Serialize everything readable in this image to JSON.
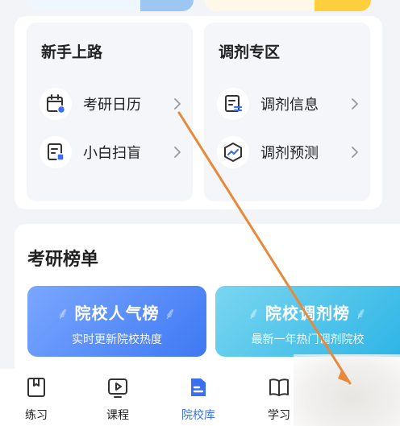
{
  "colors": {
    "accent": "#3a6ff0",
    "arrow": "#e8893a",
    "rank_blue": "#4a82f5",
    "rank_cyan": "#38bde8"
  },
  "newbie": {
    "title": "新手上路",
    "items": [
      {
        "label": "考研日历",
        "icon": "calendar-icon"
      },
      {
        "label": "小白扫盲",
        "icon": "document-icon"
      }
    ]
  },
  "adjust": {
    "title": "调剂专区",
    "items": [
      {
        "label": "调剂信息",
        "icon": "info-list-icon"
      },
      {
        "label": "调剂预测",
        "icon": "trend-icon"
      }
    ]
  },
  "ranking": {
    "title": "考研榜单",
    "cards": [
      {
        "title": "院校人气榜",
        "subtitle": "实时更新院校热度"
      },
      {
        "title": "院校调剂榜",
        "subtitle": "最新一年热门调剂院校"
      }
    ]
  },
  "tabbar": {
    "active": "院校库",
    "tabs": [
      {
        "label": "练习",
        "icon": "book-icon"
      },
      {
        "label": "课程",
        "icon": "play-icon"
      },
      {
        "label": "院校库",
        "icon": "school-icon"
      },
      {
        "label": "学习",
        "icon": "open-book-icon"
      }
    ]
  }
}
